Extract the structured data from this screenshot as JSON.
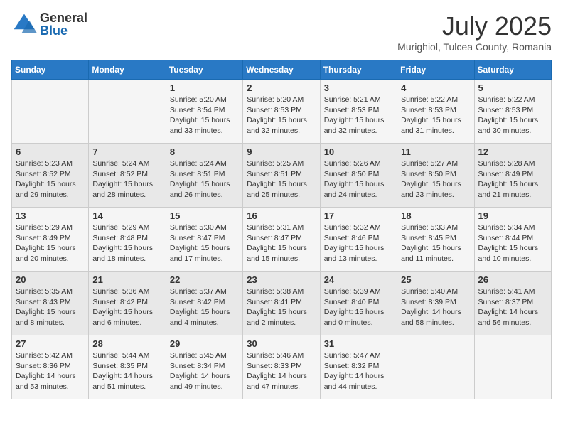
{
  "header": {
    "logo_general": "General",
    "logo_blue": "Blue",
    "month": "July 2025",
    "location": "Murighiol, Tulcea County, Romania"
  },
  "days_of_week": [
    "Sunday",
    "Monday",
    "Tuesday",
    "Wednesday",
    "Thursday",
    "Friday",
    "Saturday"
  ],
  "weeks": [
    [
      {
        "day": "",
        "sunrise": "",
        "sunset": "",
        "daylight": ""
      },
      {
        "day": "",
        "sunrise": "",
        "sunset": "",
        "daylight": ""
      },
      {
        "day": "1",
        "sunrise": "Sunrise: 5:20 AM",
        "sunset": "Sunset: 8:54 PM",
        "daylight": "Daylight: 15 hours and 33 minutes."
      },
      {
        "day": "2",
        "sunrise": "Sunrise: 5:20 AM",
        "sunset": "Sunset: 8:53 PM",
        "daylight": "Daylight: 15 hours and 32 minutes."
      },
      {
        "day": "3",
        "sunrise": "Sunrise: 5:21 AM",
        "sunset": "Sunset: 8:53 PM",
        "daylight": "Daylight: 15 hours and 32 minutes."
      },
      {
        "day": "4",
        "sunrise": "Sunrise: 5:22 AM",
        "sunset": "Sunset: 8:53 PM",
        "daylight": "Daylight: 15 hours and 31 minutes."
      },
      {
        "day": "5",
        "sunrise": "Sunrise: 5:22 AM",
        "sunset": "Sunset: 8:53 PM",
        "daylight": "Daylight: 15 hours and 30 minutes."
      }
    ],
    [
      {
        "day": "6",
        "sunrise": "Sunrise: 5:23 AM",
        "sunset": "Sunset: 8:52 PM",
        "daylight": "Daylight: 15 hours and 29 minutes."
      },
      {
        "day": "7",
        "sunrise": "Sunrise: 5:24 AM",
        "sunset": "Sunset: 8:52 PM",
        "daylight": "Daylight: 15 hours and 28 minutes."
      },
      {
        "day": "8",
        "sunrise": "Sunrise: 5:24 AM",
        "sunset": "Sunset: 8:51 PM",
        "daylight": "Daylight: 15 hours and 26 minutes."
      },
      {
        "day": "9",
        "sunrise": "Sunrise: 5:25 AM",
        "sunset": "Sunset: 8:51 PM",
        "daylight": "Daylight: 15 hours and 25 minutes."
      },
      {
        "day": "10",
        "sunrise": "Sunrise: 5:26 AM",
        "sunset": "Sunset: 8:50 PM",
        "daylight": "Daylight: 15 hours and 24 minutes."
      },
      {
        "day": "11",
        "sunrise": "Sunrise: 5:27 AM",
        "sunset": "Sunset: 8:50 PM",
        "daylight": "Daylight: 15 hours and 23 minutes."
      },
      {
        "day": "12",
        "sunrise": "Sunrise: 5:28 AM",
        "sunset": "Sunset: 8:49 PM",
        "daylight": "Daylight: 15 hours and 21 minutes."
      }
    ],
    [
      {
        "day": "13",
        "sunrise": "Sunrise: 5:29 AM",
        "sunset": "Sunset: 8:49 PM",
        "daylight": "Daylight: 15 hours and 20 minutes."
      },
      {
        "day": "14",
        "sunrise": "Sunrise: 5:29 AM",
        "sunset": "Sunset: 8:48 PM",
        "daylight": "Daylight: 15 hours and 18 minutes."
      },
      {
        "day": "15",
        "sunrise": "Sunrise: 5:30 AM",
        "sunset": "Sunset: 8:47 PM",
        "daylight": "Daylight: 15 hours and 17 minutes."
      },
      {
        "day": "16",
        "sunrise": "Sunrise: 5:31 AM",
        "sunset": "Sunset: 8:47 PM",
        "daylight": "Daylight: 15 hours and 15 minutes."
      },
      {
        "day": "17",
        "sunrise": "Sunrise: 5:32 AM",
        "sunset": "Sunset: 8:46 PM",
        "daylight": "Daylight: 15 hours and 13 minutes."
      },
      {
        "day": "18",
        "sunrise": "Sunrise: 5:33 AM",
        "sunset": "Sunset: 8:45 PM",
        "daylight": "Daylight: 15 hours and 11 minutes."
      },
      {
        "day": "19",
        "sunrise": "Sunrise: 5:34 AM",
        "sunset": "Sunset: 8:44 PM",
        "daylight": "Daylight: 15 hours and 10 minutes."
      }
    ],
    [
      {
        "day": "20",
        "sunrise": "Sunrise: 5:35 AM",
        "sunset": "Sunset: 8:43 PM",
        "daylight": "Daylight: 15 hours and 8 minutes."
      },
      {
        "day": "21",
        "sunrise": "Sunrise: 5:36 AM",
        "sunset": "Sunset: 8:42 PM",
        "daylight": "Daylight: 15 hours and 6 minutes."
      },
      {
        "day": "22",
        "sunrise": "Sunrise: 5:37 AM",
        "sunset": "Sunset: 8:42 PM",
        "daylight": "Daylight: 15 hours and 4 minutes."
      },
      {
        "day": "23",
        "sunrise": "Sunrise: 5:38 AM",
        "sunset": "Sunset: 8:41 PM",
        "daylight": "Daylight: 15 hours and 2 minutes."
      },
      {
        "day": "24",
        "sunrise": "Sunrise: 5:39 AM",
        "sunset": "Sunset: 8:40 PM",
        "daylight": "Daylight: 15 hours and 0 minutes."
      },
      {
        "day": "25",
        "sunrise": "Sunrise: 5:40 AM",
        "sunset": "Sunset: 8:39 PM",
        "daylight": "Daylight: 14 hours and 58 minutes."
      },
      {
        "day": "26",
        "sunrise": "Sunrise: 5:41 AM",
        "sunset": "Sunset: 8:37 PM",
        "daylight": "Daylight: 14 hours and 56 minutes."
      }
    ],
    [
      {
        "day": "27",
        "sunrise": "Sunrise: 5:42 AM",
        "sunset": "Sunset: 8:36 PM",
        "daylight": "Daylight: 14 hours and 53 minutes."
      },
      {
        "day": "28",
        "sunrise": "Sunrise: 5:44 AM",
        "sunset": "Sunset: 8:35 PM",
        "daylight": "Daylight: 14 hours and 51 minutes."
      },
      {
        "day": "29",
        "sunrise": "Sunrise: 5:45 AM",
        "sunset": "Sunset: 8:34 PM",
        "daylight": "Daylight: 14 hours and 49 minutes."
      },
      {
        "day": "30",
        "sunrise": "Sunrise: 5:46 AM",
        "sunset": "Sunset: 8:33 PM",
        "daylight": "Daylight: 14 hours and 47 minutes."
      },
      {
        "day": "31",
        "sunrise": "Sunrise: 5:47 AM",
        "sunset": "Sunset: 8:32 PM",
        "daylight": "Daylight: 14 hours and 44 minutes."
      },
      {
        "day": "",
        "sunrise": "",
        "sunset": "",
        "daylight": ""
      },
      {
        "day": "",
        "sunrise": "",
        "sunset": "",
        "daylight": ""
      }
    ]
  ]
}
